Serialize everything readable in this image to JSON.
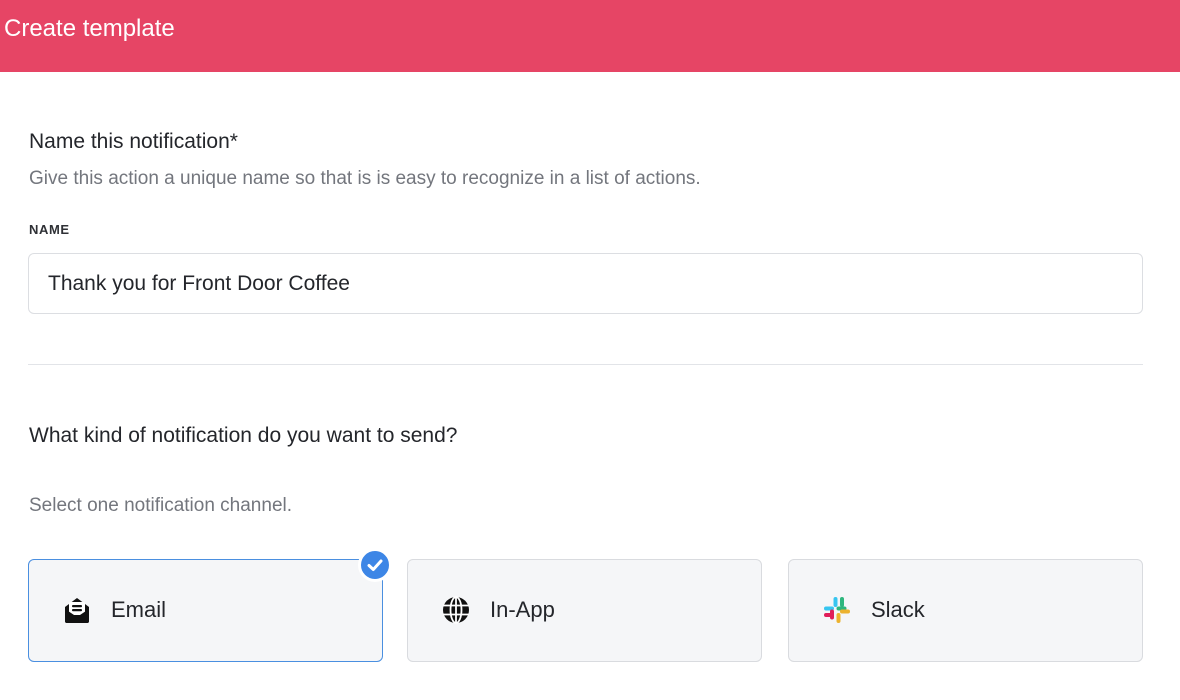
{
  "header": {
    "title": "Create template"
  },
  "name_section": {
    "title": "Name this notification*",
    "description": "Give this action a unique name so that is is easy to recognize in a list of actions.",
    "field_label": "NAME",
    "field_value": "Thank you for Front Door Coffee"
  },
  "channel_section": {
    "title": "What kind of notification do you want to send?",
    "description": "Select one notification channel.",
    "options": [
      {
        "label": "Email",
        "icon": "email-envelope-icon",
        "selected": true
      },
      {
        "label": "In-App",
        "icon": "globe-icon",
        "selected": false
      },
      {
        "label": "Slack",
        "icon": "slack-icon",
        "selected": false
      }
    ]
  },
  "colors": {
    "header": "#e64565",
    "selected_border": "#4a8fe0",
    "check_badge": "#3d86e6"
  }
}
